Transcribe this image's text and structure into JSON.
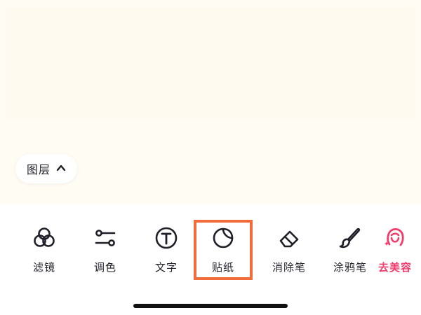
{
  "layers": {
    "label": "图层",
    "icon": "chevron-up-icon"
  },
  "toolbar": {
    "items": [
      {
        "id": "filter",
        "label": "滤镜",
        "icon": "filter-circles-icon"
      },
      {
        "id": "adjust",
        "label": "调色",
        "icon": "adjust-sliders-icon"
      },
      {
        "id": "text",
        "label": "文字",
        "icon": "text-circle-icon"
      },
      {
        "id": "sticker",
        "label": "贴纸",
        "icon": "sticker-icon"
      },
      {
        "id": "eraser",
        "label": "消除笔",
        "icon": "eraser-icon"
      },
      {
        "id": "brush",
        "label": "涂鸦笔",
        "icon": "brush-icon"
      },
      {
        "id": "beauty",
        "label": "去美容",
        "icon": "beauty-face-icon"
      }
    ]
  },
  "colors": {
    "highlight": "#f26b3a",
    "beauty_accent": "#f23b6a",
    "icon_stroke": "#1f1f2a"
  }
}
